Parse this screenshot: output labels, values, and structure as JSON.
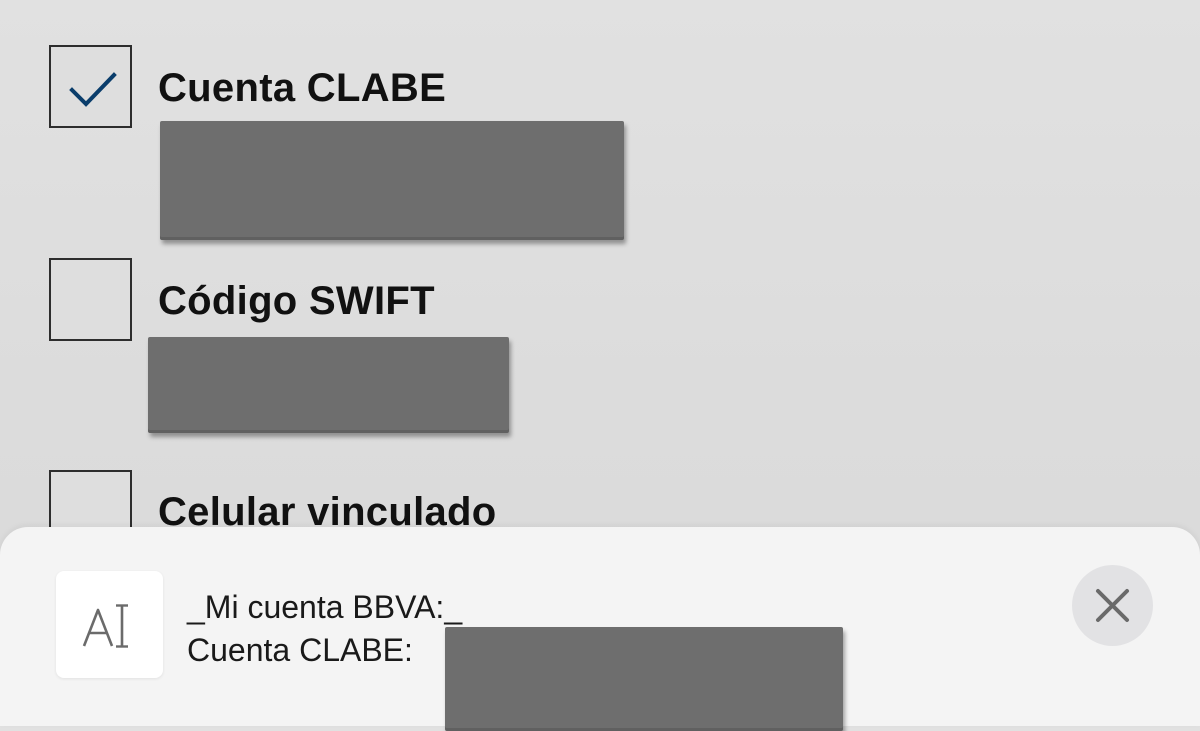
{
  "options": [
    {
      "label": "Cuenta CLABE",
      "checked": true,
      "icon": "checkmark-icon"
    },
    {
      "label": "Código SWIFT",
      "checked": false
    },
    {
      "label": "Celular vinculado",
      "checked": false
    }
  ],
  "clipboard_sheet": {
    "format_icon": "text-format-icon",
    "line1": "_Mi cuenta BBVA:_",
    "line2_label": "Cuenta CLABE:",
    "close_icon": "close-icon"
  },
  "colors": {
    "check_accent": "#0a3d6b",
    "redaction": "#6e6e6e",
    "sheet_background": "#f4f4f4"
  }
}
